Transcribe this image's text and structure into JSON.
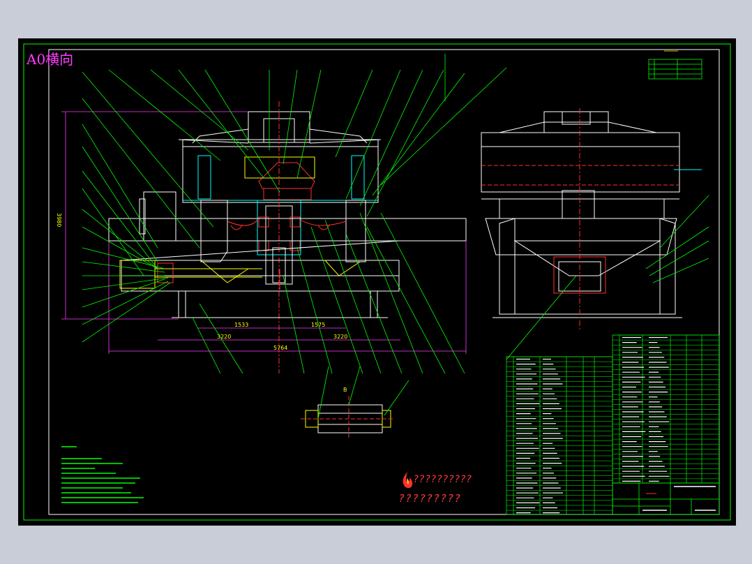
{
  "sheet": {
    "label": "A0横向",
    "logo_text": "??????????",
    "logo_sub": "?????????"
  },
  "dimensions": {
    "height_main": "3980",
    "d1": "1533",
    "d2": "1575",
    "d3": "3220",
    "d4": "3220",
    "d5": "5764"
  },
  "detail": {
    "label": "B"
  },
  "colors": {
    "background": "#000000",
    "line_white": "#ffffff",
    "line_green": "#00ff00",
    "line_cyan": "#00ffff",
    "line_red": "#ff3030",
    "line_yellow": "#ffff00",
    "line_magenta": "#ff3cff"
  }
}
